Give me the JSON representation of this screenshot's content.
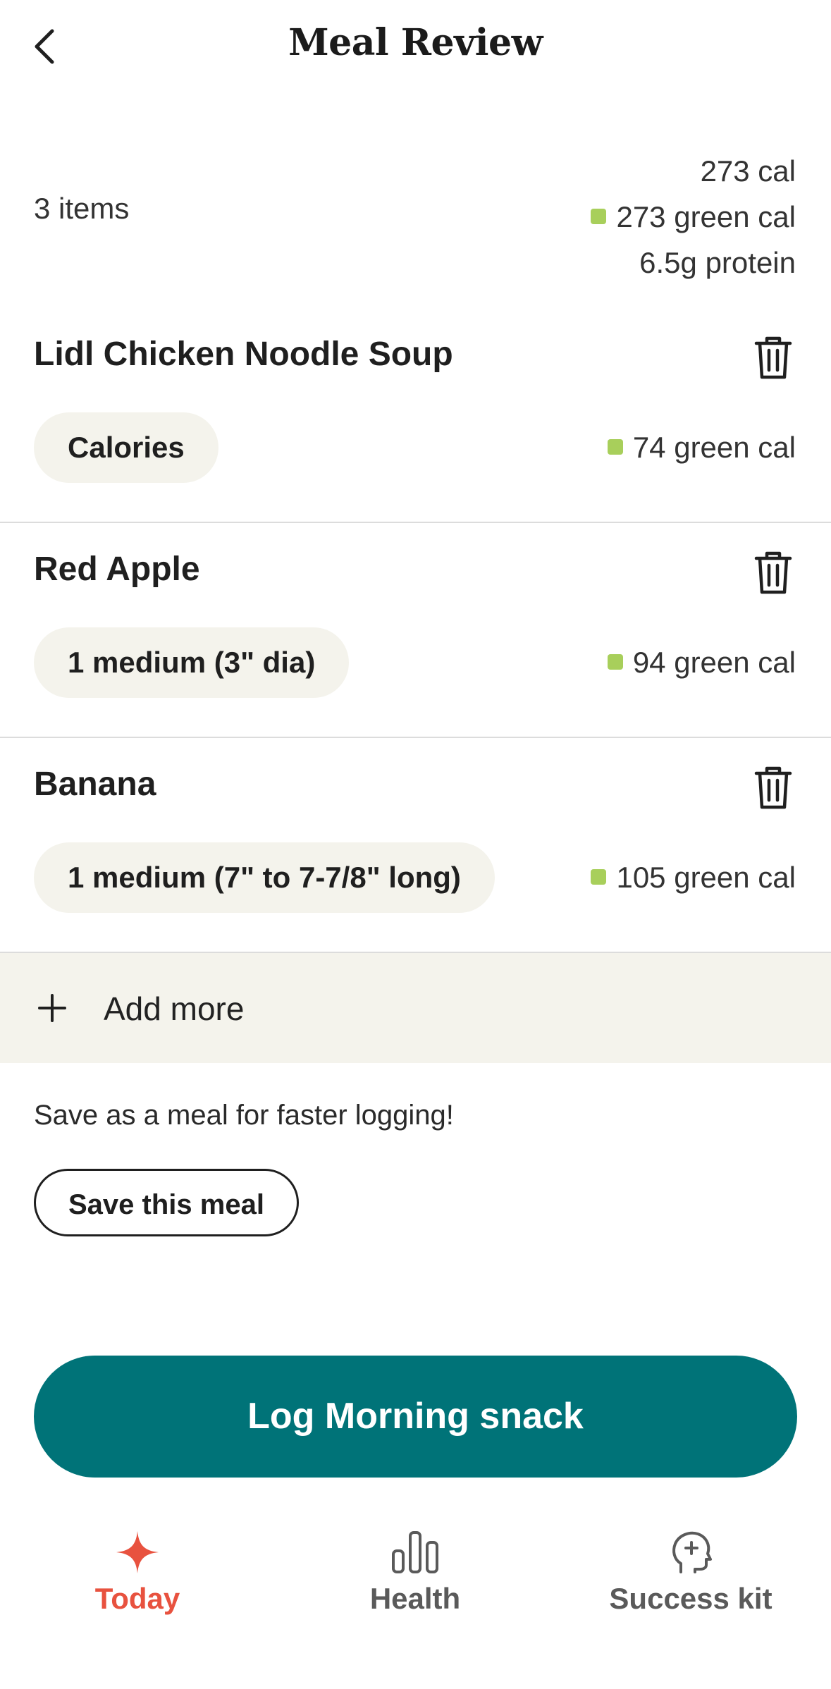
{
  "header": {
    "title": "Meal Review"
  },
  "summary": {
    "items_count": "3 items",
    "total_cal": "273 cal",
    "green_cal": "273 green cal",
    "protein": "6.5g protein",
    "green_color": "#a8cf5b"
  },
  "foods": [
    {
      "name": "Lidl Chicken Noodle Soup",
      "serving": "Calories",
      "cal": "74 green cal"
    },
    {
      "name": "Red Apple",
      "serving": "1 medium (3\" dia)",
      "cal": "94 green cal"
    },
    {
      "name": "Banana",
      "serving": "1 medium (7\" to 7-7/8\" long)",
      "cal": "105 green cal"
    }
  ],
  "add_more": {
    "label": "Add more"
  },
  "save": {
    "hint": "Save as a meal for faster logging!",
    "button": "Save this meal"
  },
  "log_button": {
    "label": "Log Morning snack",
    "color": "#007378"
  },
  "tabs": [
    {
      "label": "Today",
      "icon": "sparkle-icon",
      "active": true,
      "color": "#e8523f"
    },
    {
      "label": "Health",
      "icon": "bar-chart-icon",
      "active": false,
      "color": "#5a5a5a"
    },
    {
      "label": "Success kit",
      "icon": "head-plus-icon",
      "active": false,
      "color": "#5a5a5a"
    }
  ]
}
